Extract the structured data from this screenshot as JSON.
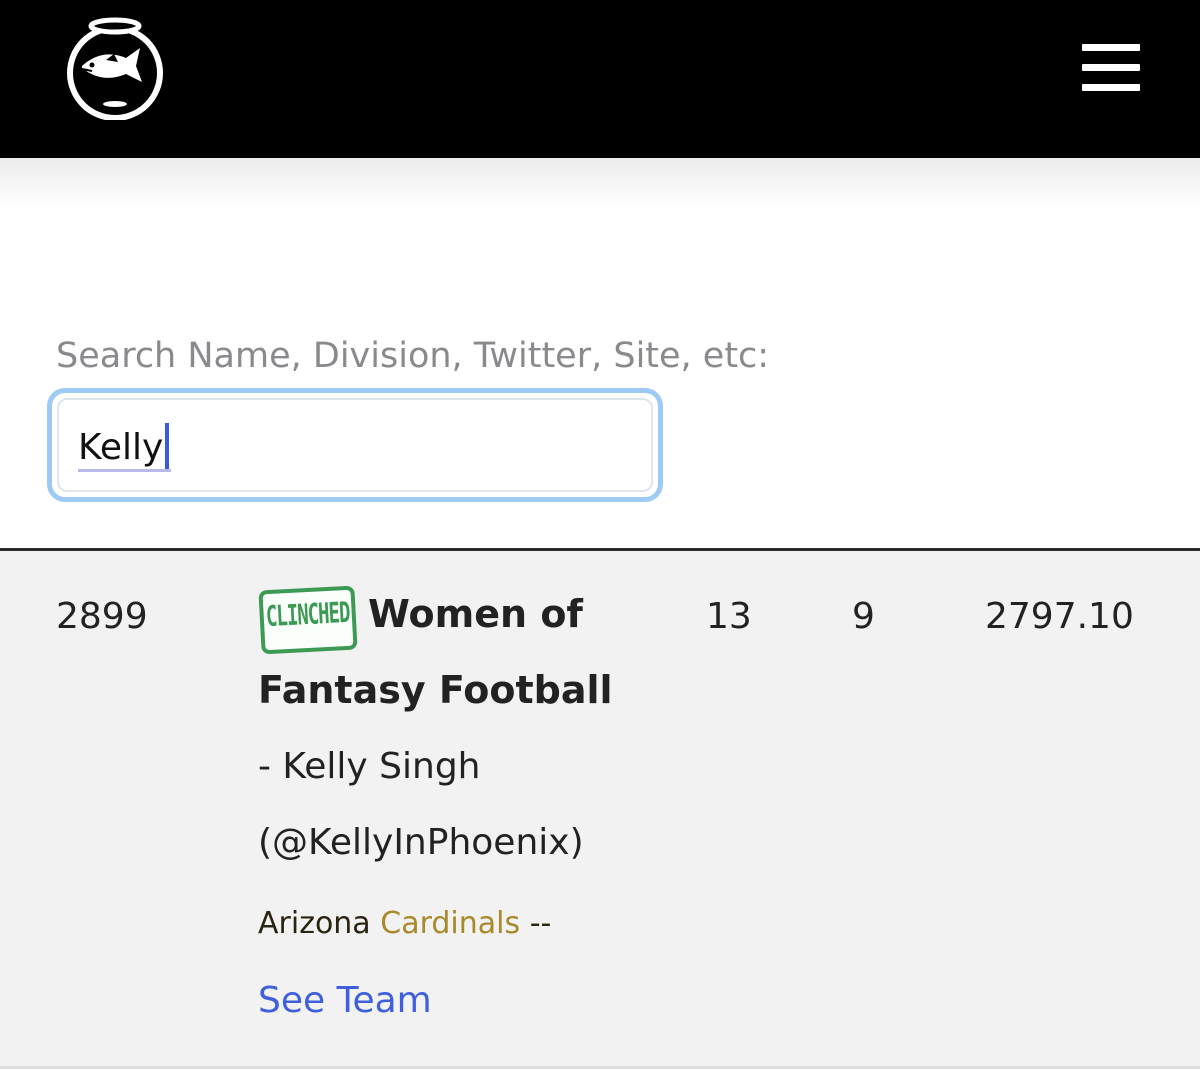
{
  "header": {
    "logo_icon": "fishbowl-logo-icon",
    "menu_icon": "hamburger-menu-icon",
    "background_color": "#000000"
  },
  "search": {
    "label": "Search Name, Division, Twitter, Site, etc:",
    "value": "Kelly",
    "focus_color": "#9ecbf5"
  },
  "results": [
    {
      "rank": "2899",
      "badge": "CLINCHED",
      "badge_color": "#3d9a55",
      "team_name_line1": "Women of",
      "team_name_line2": "Fantasy Football",
      "owner": "- Kelly Singh",
      "handle": "(@KellyInPhoenix)",
      "nfl_city": "Arizona",
      "nfl_mascot": "Cardinals",
      "nfl_suffix": "--",
      "link_label": "See Team",
      "link_color": "#3f5fdc",
      "wins": "13",
      "losses": "9",
      "points": "2797.10"
    }
  ]
}
